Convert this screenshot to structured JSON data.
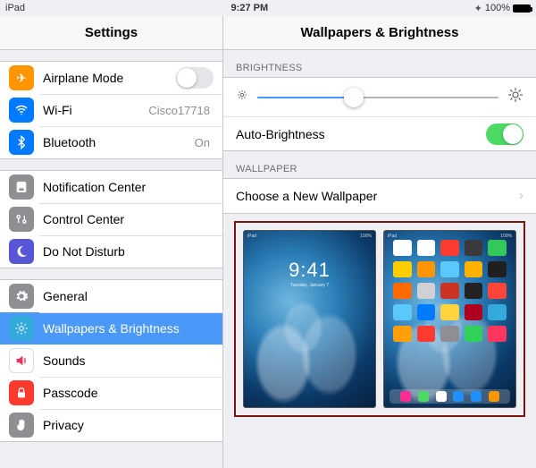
{
  "statusbar": {
    "device": "iPad",
    "time": "9:27 PM",
    "battery_pct": "100%"
  },
  "sidebar": {
    "title": "Settings",
    "g1": {
      "airplane": {
        "label": "Airplane Mode",
        "on": false
      },
      "wifi": {
        "label": "Wi-Fi",
        "value": "Cisco17718"
      },
      "bt": {
        "label": "Bluetooth",
        "value": "On"
      }
    },
    "g2": {
      "nc": {
        "label": "Notification Center"
      },
      "cc": {
        "label": "Control Center"
      },
      "dnd": {
        "label": "Do Not Disturb"
      }
    },
    "g3": {
      "general": {
        "label": "General"
      },
      "wb": {
        "label": "Wallpapers & Brightness"
      },
      "sounds": {
        "label": "Sounds"
      },
      "passcode": {
        "label": "Passcode"
      },
      "privacy": {
        "label": "Privacy"
      }
    }
  },
  "detail": {
    "title": "Wallpapers & Brightness",
    "brightness_header": "BRIGHTNESS",
    "brightness_pct": 40,
    "auto_label": "Auto-Brightness",
    "auto_on": true,
    "wallpaper_header": "WALLPAPER",
    "choose_label": "Choose a New Wallpaper",
    "lock_preview": {
      "time": "9:41",
      "date": "Tuesday, January 7"
    },
    "home_preview": {
      "app_colors": [
        "#fff",
        "#fff",
        "#ff3b30",
        "#3a3a3c",
        "#34c759",
        "#ffcc00",
        "#ff9500",
        "#5ac8fa",
        "#ffb300",
        "#1f1f1f",
        "#ff6b00",
        "#d0d0d5",
        "#cc3322",
        "#222",
        "#ff453a",
        "#5ac8fa",
        "#007aff",
        "#ffd33d",
        "#b00020",
        "#34aadc",
        "#ff9f0a",
        "#ff3b30",
        "#8e8e93",
        "#30d158",
        "#ff375f"
      ],
      "dock_colors": [
        "#ff2d92",
        "#4cd964",
        "#ffffff",
        "#1e90ff",
        "#1e90ff",
        "#ff9500"
      ]
    }
  }
}
